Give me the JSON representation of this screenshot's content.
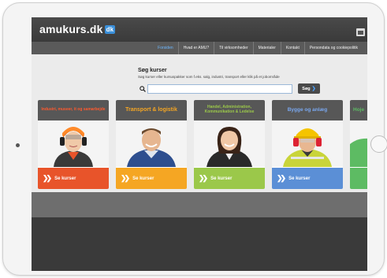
{
  "site": {
    "logo_text": "amukurs.dk",
    "logo_badge": "dk"
  },
  "nav": {
    "items": [
      {
        "label": "Forsiden",
        "active": true
      },
      {
        "label": "Hvad er AMU?",
        "active": false
      },
      {
        "label": "Til virksomheder",
        "active": false
      },
      {
        "label": "Materialer",
        "active": false
      },
      {
        "label": "Kontakt",
        "active": false
      },
      {
        "label": "Persondata og cookiepolitik",
        "active": false
      }
    ]
  },
  "search": {
    "title": "Søg kurser",
    "subtitle": "Søg kurser eller kursuspakker som f.eks. salg, industri, transport eller klik på et jobområde",
    "input_value": "",
    "button_label": "Søg"
  },
  "categories": [
    {
      "title": "Industri, museer, it og samarbejde",
      "color": "#e8542a",
      "button_label": "Se kurser"
    },
    {
      "title": "Transport & logistik",
      "color": "#f5a623",
      "button_label": "Se kurser"
    },
    {
      "title": "Handel, Administration, Kommunikation & Ledelse",
      "color": "#9bc84a",
      "button_label": "Se kurser"
    },
    {
      "title": "Bygge og anlæg",
      "color": "#5b8fd6",
      "button_label": "Se kurser"
    },
    {
      "title": "Hoje",
      "color": "#5dbb63",
      "button_label": ""
    }
  ],
  "colors": {
    "accent": "#3a8fd9",
    "nav_active": "#6db8ff",
    "header_bg": "#444444"
  }
}
